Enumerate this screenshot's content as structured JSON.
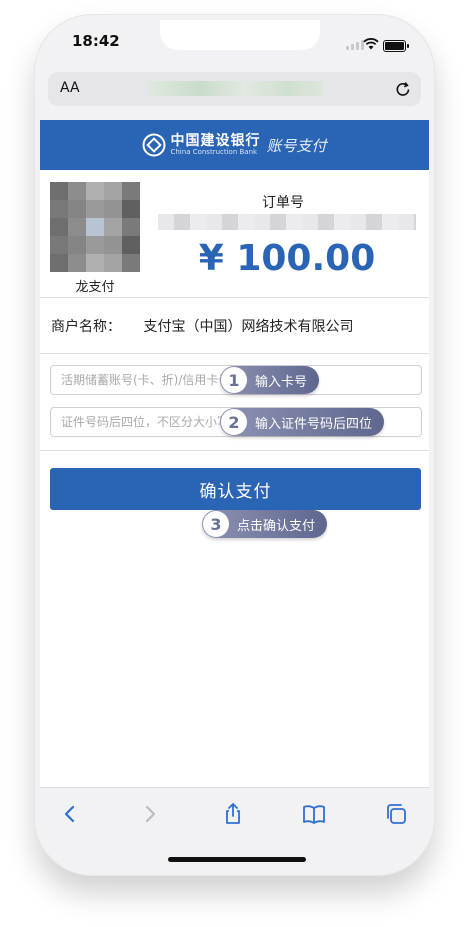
{
  "status": {
    "time": "18:42"
  },
  "browser": {
    "text_size_label": "AA"
  },
  "bank": {
    "name_zh": "中国建设银行",
    "name_en": "China Construction Bank",
    "service": "账号支付",
    "brand_color": "#2a65b5"
  },
  "order": {
    "product_label": "龙支付",
    "order_no_label": "订单号",
    "amount": "¥ 100.00"
  },
  "merchant": {
    "label": "商户名称：",
    "value": "支付宝（中国）网络技术有限公司"
  },
  "form": {
    "card_placeholder": "活期储蓄账号(卡、折)/信用卡号",
    "id_placeholder": "证件号码后四位，不区分大小写",
    "confirm_label": "确认支付"
  },
  "hints": [
    {
      "num": "1",
      "text": "输入卡号"
    },
    {
      "num": "2",
      "text": "输入证件号码后四位"
    },
    {
      "num": "3",
      "text": "点击确认支付"
    }
  ],
  "toolbar": {
    "icons": [
      "back-icon",
      "forward-icon",
      "share-icon",
      "bookmarks-icon",
      "tabs-icon"
    ]
  }
}
